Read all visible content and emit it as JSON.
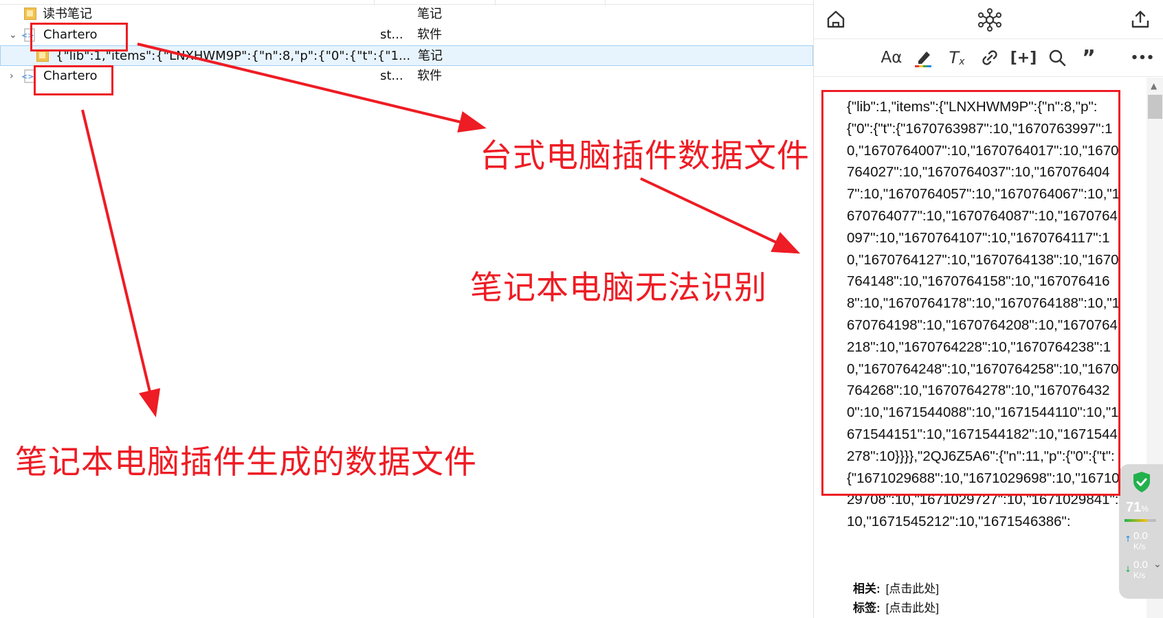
{
  "tree": {
    "rows": [
      {
        "name": "读书笔记",
        "col2": "",
        "col3": "笔记"
      },
      {
        "name": "Chartero",
        "col2": "st...",
        "col3": "软件"
      },
      {
        "name": "{\"lib\":1,\"items\":{\"LNXHWM9P\":{\"n\":8,\"p\":{\"0\":{\"t\":{\"1...",
        "col2": "",
        "col3": "笔记"
      },
      {
        "name": "Chartero",
        "col2": "st...",
        "col3": "软件"
      }
    ]
  },
  "toolbar": {
    "top": [
      "home-icon",
      "graph-icon",
      "share-icon"
    ],
    "format": [
      {
        "icon": "font-size-icon",
        "glyph": "Aα"
      },
      {
        "icon": "highlight-icon",
        "glyph": "✎"
      },
      {
        "icon": "clear-format-icon",
        "glyph": "Tx"
      },
      {
        "icon": "link-icon",
        "glyph": "🔗"
      },
      {
        "icon": "citation-icon",
        "glyph": "[+]"
      },
      {
        "icon": "search-icon",
        "glyph": "⌕"
      },
      {
        "icon": "quote-icon",
        "glyph": "”"
      },
      {
        "icon": "more-icon",
        "glyph": "•••"
      }
    ]
  },
  "note": {
    "body": "{\"lib\":1,\"items\":{\"LNXHWM9P\":{\"n\":8,\"p\":{\"0\":{\"t\":{\"1670763987\":10,\"1670763997\":10,\"1670764007\":10,\"1670764017\":10,\"1670764027\":10,\"1670764037\":10,\"1670764047\":10,\"1670764057\":10,\"1670764067\":10,\"1670764077\":10,\"1670764087\":10,\"1670764097\":10,\"1670764107\":10,\"1670764117\":10,\"1670764127\":10,\"1670764138\":10,\"1670764148\":10,\"1670764158\":10,\"1670764168\":10,\"1670764178\":10,\"1670764188\":10,\"1670764198\":10,\"1670764208\":10,\"1670764218\":10,\"1670764228\":10,\"1670764238\":10,\"1670764248\":10,\"1670764258\":10,\"1670764268\":10,\"1670764278\":10,\"1670764320\":10,\"1671544088\":10,\"1671544110\":10,\"1671544151\":10,\"1671544182\":10,\"1671544278\":10}}}},\"2QJ6Z5A6\":{\"n\":11,\"p\":{\"0\":{\"t\":{\"1671029688\":10,\"1671029698\":10,\"1671029708\":10,\"1671029727\":10,\"1671029841\":10,\"1671545212\":10,\"1671546386\":",
    "related_label": "相关:",
    "related_value": "[点击此处]",
    "tags_label": "标签:",
    "tags_value": "[点击此处]"
  },
  "widget": {
    "percent": "71",
    "percent_unit": "%",
    "percent_value": 0.71,
    "up_speed": "0.0",
    "up_unit": "K/s",
    "down_speed": "0.0",
    "down_unit": "K/s"
  },
  "annotations": {
    "desktop_label": "台式电脑插件数据文件",
    "laptop_unrecognized": "笔记本电脑无法识别",
    "laptop_generated": "笔记本电脑插件生成的数据文件"
  },
  "colors": {
    "annotation_red": "#ee1c24",
    "selection_bg": "#e8f4fd",
    "shield_green": "#22b14c"
  }
}
